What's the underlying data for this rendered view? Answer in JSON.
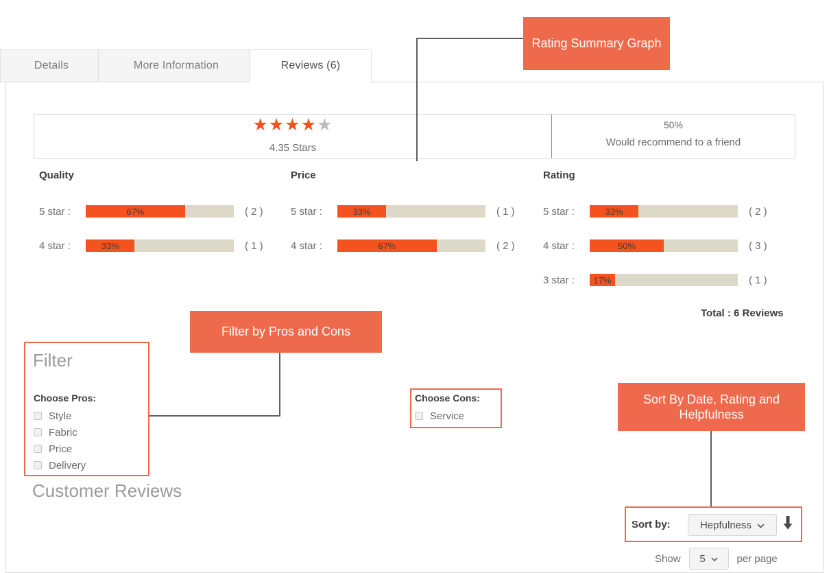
{
  "tabs": [
    {
      "label": "Details",
      "active": false
    },
    {
      "label": "More Information",
      "active": false
    },
    {
      "label": "Reviews (6)",
      "active": true
    }
  ],
  "summary": {
    "stars_filled": 4,
    "stars_total": 5,
    "stars_label": "4.35 Stars",
    "recommend_percent": "50%",
    "recommend_text": "Would recommend to a friend"
  },
  "chart_data": {
    "type": "bar",
    "title": "Rating Summary Graph",
    "xlabel": "",
    "ylabel": "",
    "xlim": [
      0,
      100
    ],
    "grid": false,
    "legend": "none",
    "groups": [
      {
        "name": "Quality",
        "categories": [
          "5 star :",
          "4 star :"
        ],
        "values": [
          67,
          33
        ],
        "value_labels": [
          "67%",
          "33%"
        ],
        "counts": [
          "( 2 )",
          "( 1 )"
        ]
      },
      {
        "name": "Price",
        "categories": [
          "5 star :",
          "4 star :"
        ],
        "values": [
          33,
          67
        ],
        "value_labels": [
          "33%",
          "67%"
        ],
        "counts": [
          "( 1 )",
          "( 2 )"
        ]
      },
      {
        "name": "Rating",
        "categories": [
          "5 star :",
          "4 star :",
          "3 star :"
        ],
        "values": [
          33,
          50,
          17
        ],
        "value_labels": [
          "33%",
          "50%",
          "17%"
        ],
        "counts": [
          "( 2 )",
          "( 3 )",
          "( 1 )"
        ]
      }
    ],
    "total_label": "Total : 6 Reviews",
    "bar_fill_color": "#f4531f",
    "bar_track_color": "#dcd9c8"
  },
  "filter": {
    "title": "Filter",
    "pros_label": "Choose Pros:",
    "pros": [
      "Style",
      "Fabric",
      "Price",
      "Delivery"
    ],
    "cons_label": "Choose Cons:",
    "cons": [
      "Service"
    ]
  },
  "customer_reviews_heading": "Customer Reviews",
  "sort": {
    "label": "Sort by:",
    "value": "Hepfulness",
    "chevron": "⌄",
    "direction_icon": "⬇",
    "show_label": "Show",
    "per_page_value": "5",
    "per_page_label": "per page"
  },
  "callouts": {
    "rating_summary": "Rating Summary Graph",
    "filter_pros_cons": "Filter by Pros and Cons",
    "sort_by": "Sort By Date, Rating and Helpfulness"
  },
  "colors": {
    "accent_bar": "#f4531f",
    "callout": "#ef6a4c",
    "track": "#dcd9c8",
    "star_on": "#f4531f",
    "star_off": "#bdbdbd"
  }
}
